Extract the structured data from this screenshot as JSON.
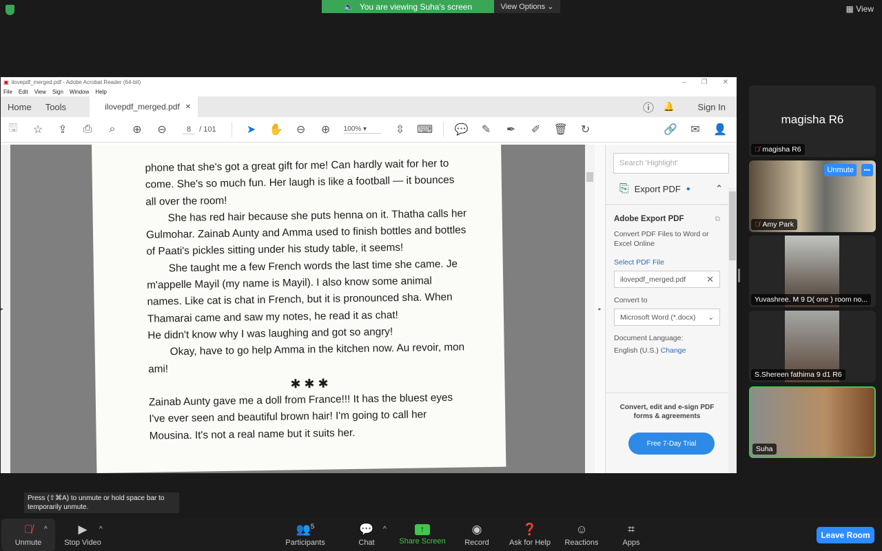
{
  "zoom": {
    "banner": "You are viewing Suha's screen",
    "view_options": "View Options",
    "view": "View",
    "tooltip": "Press (⇧⌘A) to unmute or hold space bar to temporarily unmute.",
    "toolbar": [
      {
        "label": "Unmute",
        "icon": "mic-muted-icon"
      },
      {
        "label": "Stop Video",
        "icon": "video-icon"
      },
      {
        "label": "Participants",
        "icon": "participants-icon",
        "count": "5"
      },
      {
        "label": "Chat",
        "icon": "chat-icon"
      },
      {
        "label": "Share Screen",
        "icon": "share-icon"
      },
      {
        "label": "Record",
        "icon": "record-icon"
      },
      {
        "label": "Ask for Help",
        "icon": "help-icon"
      },
      {
        "label": "Reactions",
        "icon": "reactions-icon"
      },
      {
        "label": "Apps",
        "icon": "apps-icon"
      }
    ],
    "leave": "Leave Room",
    "participants": [
      {
        "name": "magisha R6",
        "big": "magisha R6"
      },
      {
        "name": "Amy Park",
        "unmute": "Unmute",
        "more": "•••"
      },
      {
        "name": "Yuvashree. M 9 D( one ) room no..."
      },
      {
        "name": "S.Shereen fathima 9 d1  R6"
      },
      {
        "name": "Suha"
      }
    ]
  },
  "acrobat": {
    "title": "ilovepdf_merged.pdf - Adobe Acrobat Reader (64-bit)",
    "menu": [
      "File",
      "Edit",
      "View",
      "Sign",
      "Window",
      "Help"
    ],
    "home": "Home",
    "tools": "Tools",
    "tab": "ilovepdf_merged.pdf",
    "signin": "Sign In",
    "page_current": "8",
    "page_total": "/ 101",
    "zoom": "100%",
    "page_text": [
      "phone that she's got a great gift for me! Can hardly wait for her to come. She's so much fun. Her laugh is like a football — it bounces all over the room!",
      "She has red hair because she puts henna on it. Thatha calls her Gulmohar. Zainab Aunty and Amma used to finish bottles and bottles of Paati's pickles sitting under his study table, it seems!",
      "She taught me a few French words the last time she came. Je m'appelle Mayil (my name is Mayil). I also know some animal names. Like cat is chat in French, but it is pronounced sha. When Thamarai came and saw my notes, he read it as chat!",
      "He didn't know why I was laughing and got so angry!",
      "Okay, have to go help Amma in the kitchen now. Au revoir, mon ami!",
      "✱ ✱ ✱",
      "Zainab Aunty gave me a doll from France!!! It has the bluest eyes I've ever seen and beautiful brown hair! I'm going to call her Mousina. It's not a real name but it suits her."
    ],
    "panel": {
      "search_placeholder": "Search 'Highlight'",
      "export_title": "Export PDF",
      "heading": "Adobe Export PDF",
      "desc": "Convert PDF Files to Word or Excel Online",
      "select": "Select PDF File",
      "file": "ilovepdf_merged.pdf",
      "convert_to": "Convert to",
      "format": "Microsoft Word (*.docx)",
      "lang_label": "Document Language:",
      "lang": "English (U.S.)",
      "change": "Change",
      "promo": "Convert, edit and e-sign PDF forms & agreements",
      "trial": "Free 7-Day Trial"
    }
  }
}
